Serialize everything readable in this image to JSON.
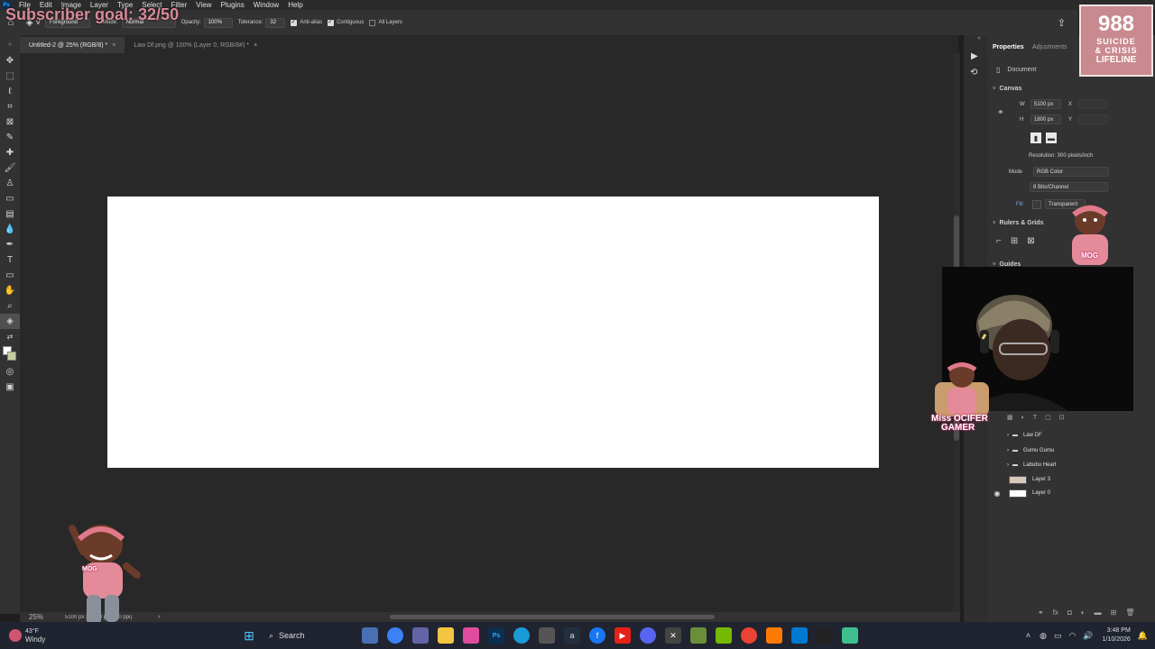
{
  "app": {
    "name": "Photoshop"
  },
  "menu": [
    "File",
    "Edit",
    "Image",
    "Layer",
    "Type",
    "Select",
    "Filter",
    "View",
    "Plugins",
    "Window",
    "Help"
  ],
  "options_bar": {
    "fill_source": "Foreground",
    "mode_label": "Mode:",
    "mode_value": "Normal",
    "opacity_label": "Opacity:",
    "opacity_value": "100%",
    "tolerance_label": "Tolerance:",
    "tolerance_value": "32",
    "antialias_label": "Anti-alias",
    "contiguous_label": "Contiguous",
    "all_layers_label": "All Layers"
  },
  "tabs": [
    {
      "label": "Untitled-2 @ 25% (RGB/8) *"
    },
    {
      "label": "Law Df.png @ 100% (Layer 0, RGB/8#) *"
    }
  ],
  "status_bar": {
    "zoom": "25%",
    "doc_info": "5100 px x 1800 px (300 ppi)"
  },
  "properties": {
    "tab_properties": "Properties",
    "tab_adjustments": "Adjustments",
    "document_label": "Document",
    "canvas_section": "Canvas",
    "w_label": "W",
    "w_value": "5100 px",
    "x_label": "X",
    "h_label": "H",
    "h_value": "1800 px",
    "y_label": "Y",
    "resolution": "Resolution: 300 pixels/inch",
    "mode_label": "Mode",
    "mode_value": "RGB Color",
    "bits_value": "8 Bits/Channel",
    "fill_label": "Fill",
    "fill_value": "Transparent",
    "rulers_section": "Rulers & Grids",
    "guides_section": "Guides"
  },
  "layers": [
    {
      "name": "Law DF",
      "type": "group",
      "visible": false
    },
    {
      "name": "Gumu Gumu",
      "type": "group",
      "visible": false
    },
    {
      "name": "Labubu Heart",
      "type": "group",
      "visible": false
    },
    {
      "name": "Layer 3",
      "type": "layer",
      "visible": false
    },
    {
      "name": "Layer 0",
      "type": "layer",
      "visible": true
    }
  ],
  "overlays": {
    "subscriber_goal": "Subscriber goal: 32/50",
    "lifeline_number": "988",
    "lifeline_line1": "SUICIDE",
    "lifeline_line2": "& CRISIS",
    "lifeline_line3": "LIFELINE",
    "sticker_name_1": "Miss OCIFER",
    "sticker_name_2": "GAMER",
    "hoodie_text": "MOG"
  },
  "taskbar": {
    "weather_temp": "43°F",
    "weather_desc": "Windy",
    "search_label": "Search",
    "time": "3:48 PM",
    "date": "1/10/2026"
  },
  "colors": {
    "workspace": "#282828",
    "panel": "#323232",
    "canvas": "#ffffff",
    "accent": "#31a8ff"
  }
}
